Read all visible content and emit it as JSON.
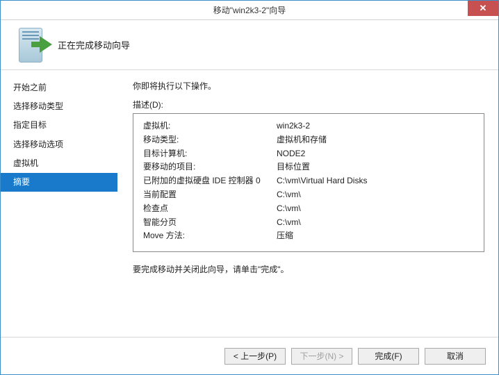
{
  "window": {
    "title": "移动\"win2k3-2\"向导"
  },
  "header": {
    "title": "正在完成移动向导"
  },
  "sidebar": {
    "items": [
      {
        "label": "开始之前"
      },
      {
        "label": "选择移动类型"
      },
      {
        "label": "指定目标"
      },
      {
        "label": "选择移动选项"
      },
      {
        "label": "虚拟机"
      },
      {
        "label": "摘要"
      }
    ],
    "selected_index": 5
  },
  "main": {
    "intro": "你即将执行以下操作。",
    "desc_label": "描述(D):",
    "rows": [
      {
        "key": "虚拟机:",
        "val": "win2k3-2"
      },
      {
        "key": "移动类型:",
        "val": "虚拟机和存储"
      },
      {
        "key": "目标计算机:",
        "val": "NODE2"
      },
      {
        "key": "要移动的项目:",
        "val": "目标位置"
      },
      {
        "key": "已附加的虚拟硬盘 IDE 控制器 0",
        "val": "C:\\vm\\Virtual Hard Disks"
      },
      {
        "key": "当前配置",
        "val": "C:\\vm\\"
      },
      {
        "key": "检查点",
        "val": "C:\\vm\\"
      },
      {
        "key": "智能分页",
        "val": "C:\\vm\\"
      },
      {
        "key": "Move 方法:",
        "val": "压缩"
      }
    ],
    "post_text": "要完成移动并关闭此向导，请单击\"完成\"。"
  },
  "footer": {
    "prev": "< 上一步(P)",
    "next": "下一步(N) >",
    "finish": "完成(F)",
    "cancel": "取消"
  }
}
